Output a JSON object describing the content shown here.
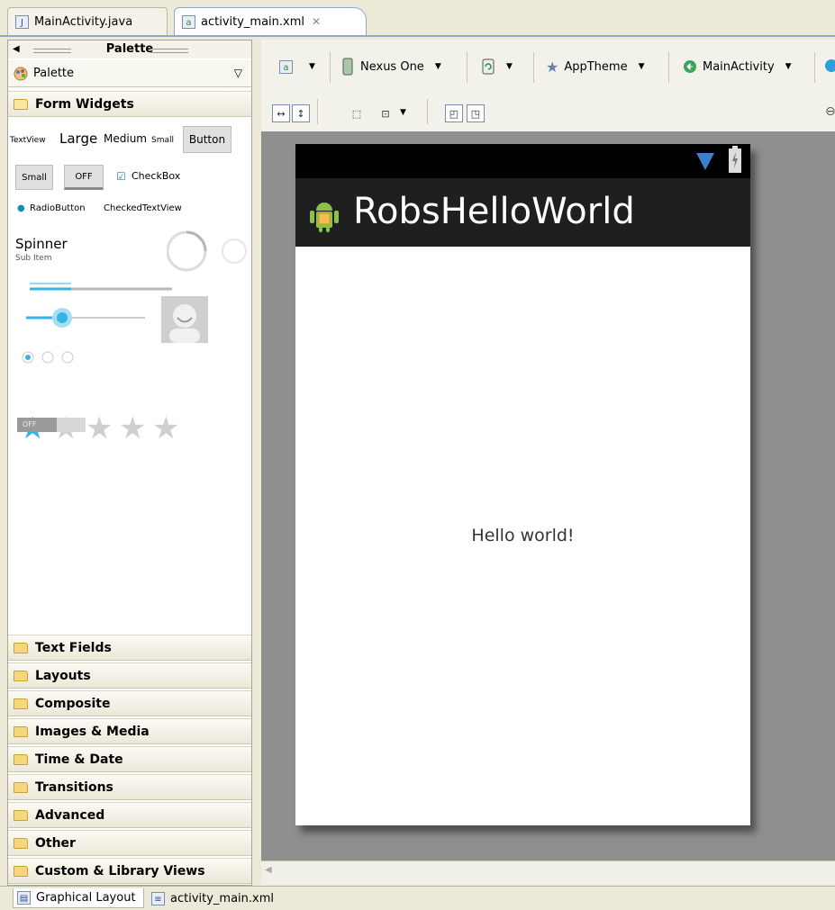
{
  "editor_tabs": [
    {
      "label": "MainActivity.java",
      "icon": "java-file-icon"
    },
    {
      "label": "activity_main.xml",
      "icon": "xml-file-icon",
      "active": true
    }
  ],
  "palette": {
    "header": "Palette",
    "selector_label": "Palette",
    "open_category": "Form Widgets",
    "widgets": {
      "textview": "TextView",
      "large": "Large",
      "medium": "Medium",
      "small": "Small",
      "button": "Button",
      "small_button": "Small",
      "toggle": "OFF",
      "checkbox": "CheckBox",
      "radiobutton": "RadioButton",
      "checkedtextview": "CheckedTextView",
      "spinner": "Spinner",
      "spinner_sub": "Sub Item",
      "switch": "OFF"
    },
    "categories": [
      "Text Fields",
      "Layouts",
      "Composite",
      "Images & Media",
      "Time & Date",
      "Transitions",
      "Advanced",
      "Other",
      "Custom & Library Views"
    ]
  },
  "toolbar": {
    "device": "Nexus One",
    "theme": "AppTheme",
    "activity": "MainActivity"
  },
  "device_preview": {
    "app_title": "RobsHelloWorld",
    "body_text": "Hello world!"
  },
  "bottom_tabs": [
    {
      "label": "Graphical Layout",
      "active": true
    },
    {
      "label": "activity_main.xml"
    }
  ],
  "colors": {
    "accent": "#33b5e5",
    "actionbar": "#1f1f1f"
  }
}
